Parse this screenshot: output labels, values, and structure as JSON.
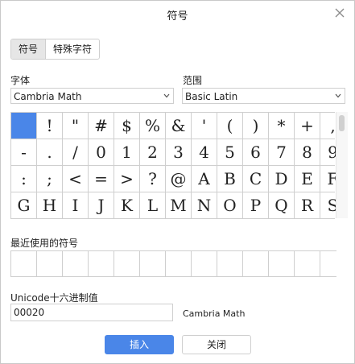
{
  "dialog": {
    "title": "符号",
    "close_icon": "close-icon"
  },
  "tabs": [
    {
      "label": "符号",
      "active": true
    },
    {
      "label": "特殊字符",
      "active": false
    }
  ],
  "font": {
    "label": "字体",
    "value": "Cambria Math"
  },
  "range": {
    "label": "范围",
    "value": "Basic Latin"
  },
  "symbols": [
    " ",
    "!",
    "\"",
    "#",
    "$",
    "%",
    "&",
    "'",
    "(",
    ")",
    "*",
    "+",
    ",",
    "-",
    ".",
    "/",
    "0",
    "1",
    "2",
    "3",
    "4",
    "5",
    "6",
    "7",
    "8",
    "9",
    ":",
    ";",
    "<",
    "=",
    ">",
    "?",
    "@",
    "A",
    "B",
    "C",
    "D",
    "E",
    "F",
    "G",
    "H",
    "I",
    "J",
    "K",
    "L",
    "M",
    "N",
    "O",
    "P",
    "Q",
    "R",
    "S"
  ],
  "selected_index": 0,
  "recent": {
    "label": "最近使用的符号",
    "count": 13
  },
  "unicode": {
    "label": "Unicode十六进制值",
    "value": "00020",
    "font_name": "Cambria Math"
  },
  "buttons": {
    "insert": "插入",
    "close": "关闭"
  },
  "colors": {
    "accent": "#4a86e8",
    "border": "#cfcfcf"
  }
}
